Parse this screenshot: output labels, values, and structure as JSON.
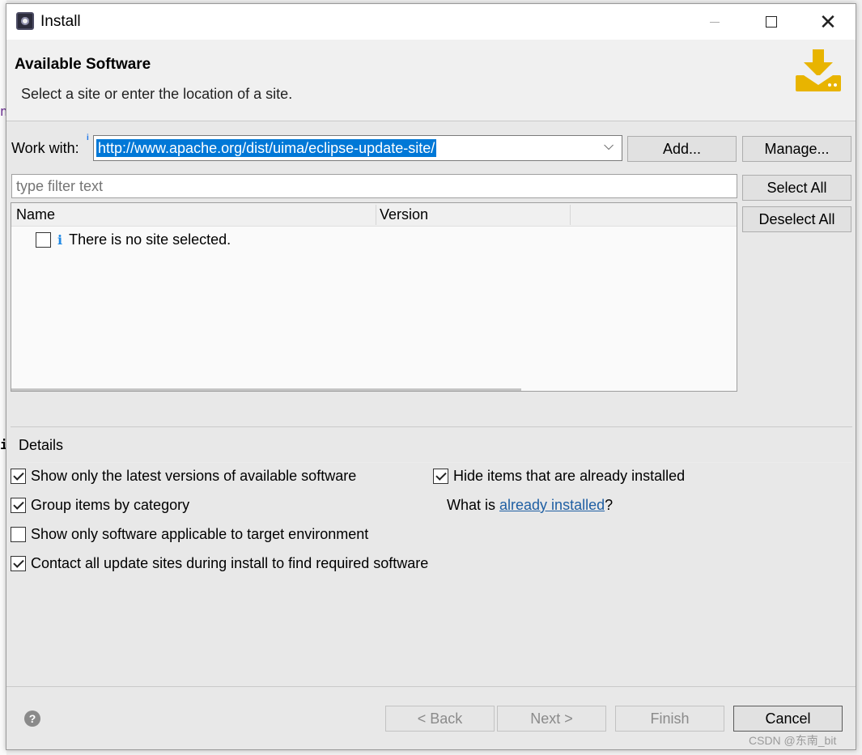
{
  "window": {
    "title": "Install"
  },
  "header": {
    "title": "Available Software",
    "description": "Select a site or enter the location of a site."
  },
  "work_with": {
    "label": "Work with:",
    "value": "http://www.apache.org/dist/uima/eclipse-update-site/",
    "add_button": "Add...",
    "manage_button": "Manage..."
  },
  "filter": {
    "placeholder": "type filter text"
  },
  "buttons": {
    "select_all": "Select All",
    "deselect_all": "Deselect All"
  },
  "tree": {
    "columns": [
      "Name",
      "Version"
    ],
    "rows": [
      {
        "checked": false,
        "icon": "info-icon",
        "text": "There is no site selected."
      }
    ]
  },
  "details": {
    "label": "Details",
    "options": {
      "latest": {
        "label": "Show only the latest versions of available software",
        "checked": true
      },
      "group": {
        "label": "Group items by category",
        "checked": true
      },
      "target": {
        "label": "Show only software applicable to target environment",
        "checked": false
      },
      "contact": {
        "label": "Contact all update sites during install to find required software",
        "checked": true
      },
      "hide": {
        "label": "Hide items that are already installed",
        "checked": true
      }
    },
    "what_installed_prefix": "What is ",
    "what_installed_link": "already installed",
    "what_installed_suffix": "?"
  },
  "footer": {
    "back": "< Back",
    "next": "Next >",
    "finish": "Finish",
    "cancel": "Cancel"
  },
  "watermark": "CSDN @东南_bit",
  "colors": {
    "selection": "#0078d7",
    "banner_icon": "#e8b400",
    "link": "#1f5fa3"
  }
}
